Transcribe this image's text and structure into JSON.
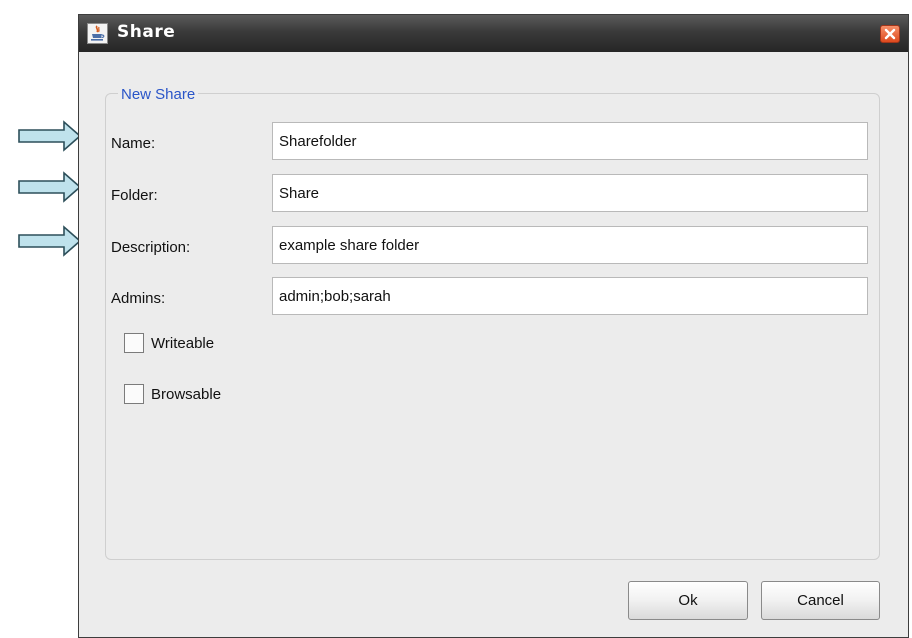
{
  "window": {
    "title": "Share"
  },
  "group": {
    "title": "New Share"
  },
  "fields": [
    {
      "label": "Name:",
      "value": "Sharefolder"
    },
    {
      "label": "Folder:",
      "value": "Share"
    },
    {
      "label": "Description:",
      "value": "example share folder"
    },
    {
      "label": "Admins:",
      "value": "admin;bob;sarah"
    }
  ],
  "checkboxes": [
    {
      "label": "Writeable",
      "checked": false
    },
    {
      "label": "Browsable",
      "checked": false
    }
  ],
  "buttons": {
    "ok": "Ok",
    "cancel": "Cancel"
  },
  "icons": {
    "title": "java-app-icon",
    "close": "close-icon",
    "arrow": "right-arrow-icon"
  },
  "colors": {
    "titlebar": "#2e2e2e",
    "group_title": "#2a55c8",
    "arrow_fill": "#bfe2ec",
    "close": "#e0532a"
  }
}
